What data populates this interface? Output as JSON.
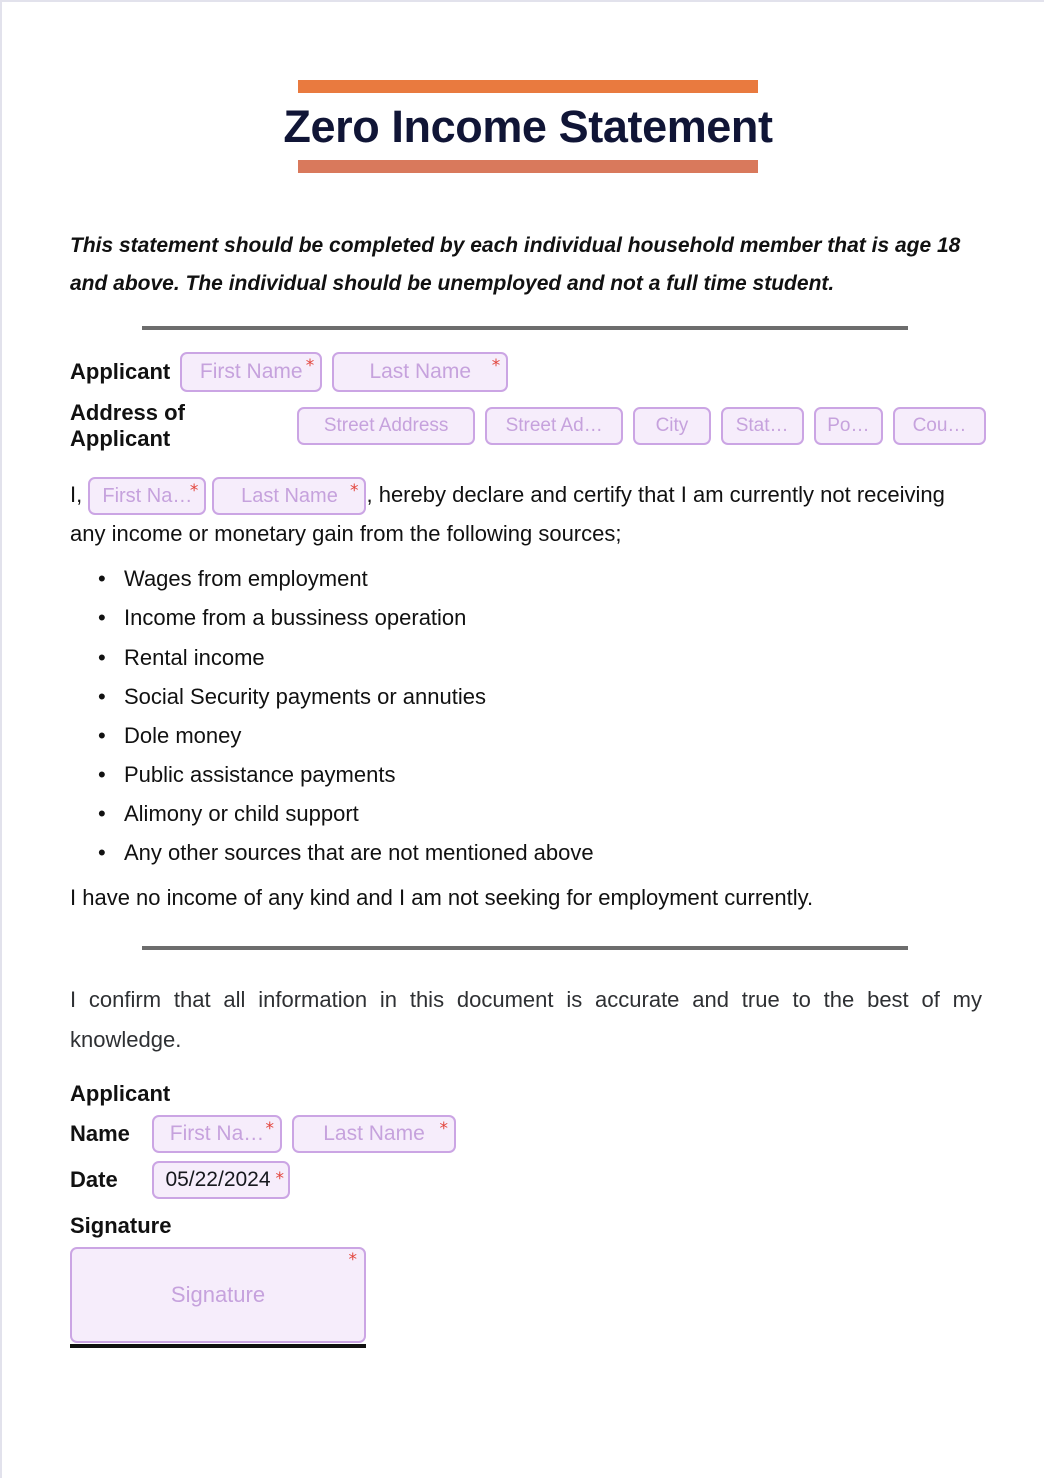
{
  "header": {
    "title": "Zero Income Statement",
    "bar_top_color": "#e97a3f",
    "bar_bottom_color": "#d9795c",
    "title_color": "#101536"
  },
  "intro": {
    "text": "This statement should be completed by each individual household member that is age 18 and above. The individual should be unemployed and not a full time student."
  },
  "applicant_row": {
    "label": "Applicant",
    "first_name_placeholder": "First Name",
    "last_name_placeholder": "Last Name",
    "required_mark": "*"
  },
  "address_row": {
    "label": "Address of Applicant",
    "street1_placeholder": "Street Address",
    "street2_placeholder": "Street Ad…",
    "city_placeholder": "City",
    "state_placeholder": "Stat…",
    "postal_placeholder": "Po…",
    "country_placeholder": "Cou…"
  },
  "declaration": {
    "lead": "I,",
    "first_name_placeholder": "First Na…",
    "last_name_placeholder": "Last Name",
    "after_names": ", hereby declare and certify that I am currently not receiving any income or monetary gain from the following sources;",
    "sources": [
      "Wages from employment",
      "Income from a bussiness operation",
      "Rental income",
      "Social Security payments or annuties",
      "Dole money",
      "Public assistance payments",
      "Alimony or child support",
      "Any other sources that are not mentioned above"
    ],
    "closing": "I have no income of any kind and I am not seeking for employment currently."
  },
  "confirmation": {
    "text": "I confirm that all information in this document is accurate and true to the best of my knowledge."
  },
  "signature_section": {
    "applicant_heading": "Applicant",
    "name_label": "Name",
    "first_name_placeholder": "First Na…",
    "last_name_placeholder": "Last Name",
    "date_label": "Date",
    "date_value": "05/22/2024",
    "signature_label": "Signature",
    "signature_placeholder": "Signature",
    "required_mark": "*"
  },
  "theme": {
    "field_fill": "#f6edfb",
    "field_border": "#cba5e4",
    "placeholder_color": "#c6a2dd",
    "required_color": "#e2453c",
    "divider_color": "#6d6d6d",
    "text_color": "#111111"
  }
}
